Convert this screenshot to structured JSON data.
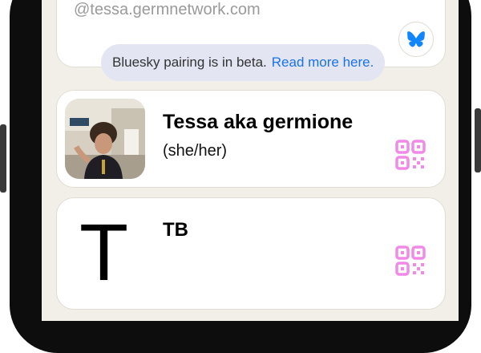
{
  "identity": {
    "handle": "@tessa.germnetwork.com",
    "bluesky_icon": "butterfly-icon"
  },
  "banner": {
    "text": "Bluesky pairing is in beta.",
    "link_text": "Read more here."
  },
  "profiles": [
    {
      "name": "Tessa aka germione",
      "pronouns": "(she/her)",
      "avatar": "photo",
      "qr_icon": "qr-code-icon"
    },
    {
      "name": "TB",
      "avatar_letter": "T",
      "qr_icon": "qr-code-icon"
    }
  ],
  "colors": {
    "background": "#f2efe9",
    "link": "#1a73e8",
    "bluesky_blue": "#1185fe",
    "qr_pink": "#f08ae6",
    "banner_bg": "#e3e6f2"
  }
}
